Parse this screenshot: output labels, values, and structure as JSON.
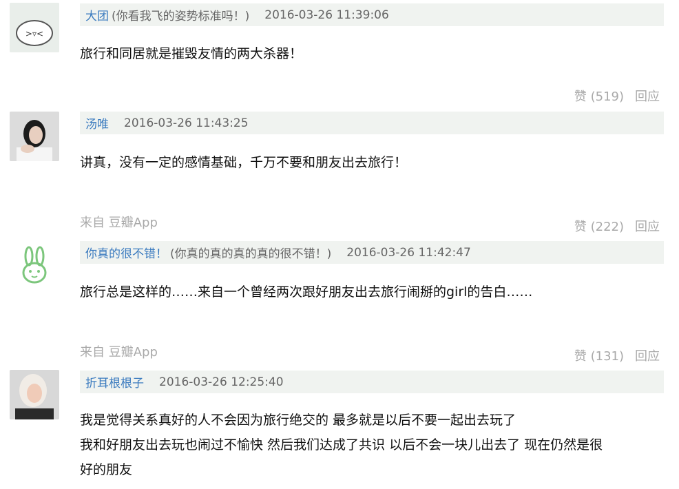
{
  "comments": [
    {
      "user": "大团",
      "signature": "(你看我飞的姿势标准吗！)",
      "time": "2016-03-26 11:39:06",
      "text": [
        "旅行和同居就是摧毁友情的两大杀器！"
      ],
      "from": "",
      "like_label": "赞",
      "like_count": "(519)",
      "reply_label": "回应",
      "avatar": "dumpling-face-avatar"
    },
    {
      "user": "汤唯",
      "signature": "",
      "time": "2016-03-26 11:43:25",
      "text": [
        "讲真，没有一定的感情基础，千万不要和朋友出去旅行！"
      ],
      "from": "来自 豆瓣App",
      "like_label": "赞",
      "like_count": "(222)",
      "reply_label": "回应",
      "avatar": "woman-photo-avatar"
    },
    {
      "user": "你真的很不错！",
      "signature": "(你真的真的真的真的很不错！)",
      "time": "2016-03-26 11:42:47",
      "text": [
        "旅行总是这样的……来自一个曾经两次跟好朋友出去旅行闹掰的girl的告白……"
      ],
      "from": "来自 豆瓣App",
      "like_label": "赞",
      "like_count": "(131)",
      "reply_label": "回应",
      "avatar": "rabbit-avatar"
    },
    {
      "user": "折耳根根子",
      "signature": "",
      "time": "2016-03-26 12:25:40",
      "text": [
        "我是觉得关系真好的人不会因为旅行绝交的 最多就是以后不要一起出去玩了",
        "我和好朋友出去玩也闹过不愉快 然后我们达成了共识 以后不会一块儿出去了 现在仍然是很",
        "好的朋友"
      ],
      "from": "",
      "like_label": "",
      "like_count": "",
      "reply_label": "",
      "avatar": "blonde-woman-photo-avatar"
    }
  ]
}
